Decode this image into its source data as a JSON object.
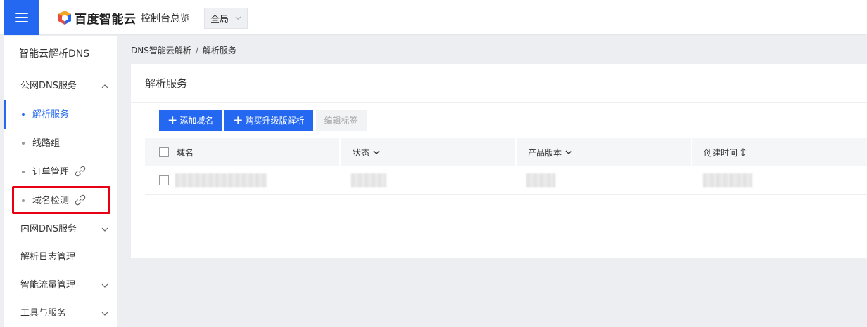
{
  "topbar": {
    "brand": "百度智能云",
    "console_link": "控制台总览",
    "region": "全局"
  },
  "sidebar": {
    "title": "智能云解析DNS",
    "public_group": "公网DNS服务",
    "public_items": [
      {
        "label": "解析服务",
        "active": true
      },
      {
        "label": "线路组",
        "active": false
      },
      {
        "label": "订单管理",
        "active": false,
        "external": true
      },
      {
        "label": "域名检测",
        "active": false,
        "external": true
      }
    ],
    "private_group": "内网DNS服务",
    "log_item": "解析日志管理",
    "traffic_group": "智能流量管理",
    "tools_group": "工具与服务"
  },
  "breadcrumb": {
    "root": "DNS智能云解析",
    "separator": "/",
    "current": "解析服务"
  },
  "card": {
    "title": "解析服务"
  },
  "toolbar": {
    "add_domain": "添加域名",
    "buy_upgrade": "购买升级版解析",
    "edit_tags": "编辑标签"
  },
  "table": {
    "columns": {
      "domain": "域名",
      "status": "状态",
      "version": "产品版本",
      "created": "创建时间"
    }
  },
  "colors": {
    "primary": "#2468f2",
    "highlight": "#e60012"
  }
}
